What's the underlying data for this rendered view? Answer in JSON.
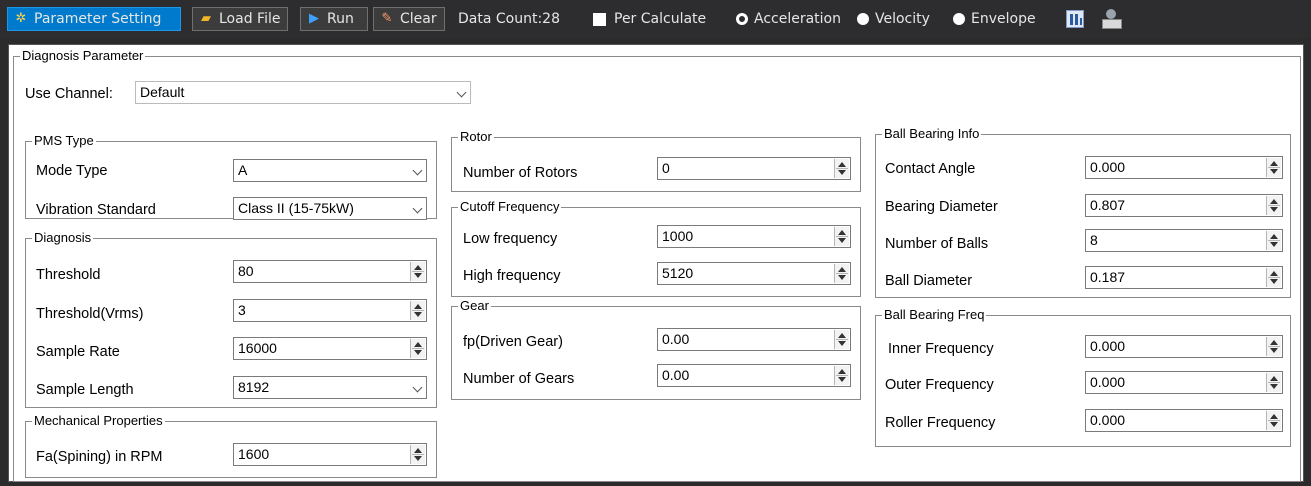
{
  "toolbar": {
    "param_setting": "Parameter Setting",
    "load_file": "Load File",
    "run": "Run",
    "clear": "Clear",
    "data_count": "Data Count:28",
    "per_calculate": "Per Calculate",
    "acceleration": "Acceleration",
    "velocity": "Velocity",
    "envelope": "Envelope",
    "selected_mode": "Acceleration"
  },
  "diagnosis": {
    "title": "Diagnosis Parameter",
    "use_channel_label": "Use Channel:",
    "use_channel_value": "Default"
  },
  "pms": {
    "title": "PMS Type",
    "mode_type_label": "Mode Type",
    "mode_type_value": "A",
    "vib_std_label": "Vibration Standard",
    "vib_std_value": "Class II (15-75kW)"
  },
  "diag": {
    "title": "Diagnosis",
    "threshold_label": "Threshold",
    "threshold_value": "80",
    "threshold_vrms_label": "Threshold(Vrms)",
    "threshold_vrms_value": "3",
    "sample_rate_label": "Sample Rate",
    "sample_rate_value": "16000",
    "sample_length_label": "Sample Length",
    "sample_length_value": "8192"
  },
  "mech": {
    "title": "Mechanical Properties",
    "fa_label": "Fa(Spining) in RPM",
    "fa_value": "1600"
  },
  "rotor": {
    "title": "Rotor",
    "num_label": "Number of Rotors",
    "num_value": "0"
  },
  "cutoff": {
    "title": "Cutoff Frequency",
    "low_label": "Low frequency",
    "low_value": "1000",
    "high_label": "High frequency",
    "high_value": "5120"
  },
  "gear": {
    "title": "Gear",
    "fp_label": "fp(Driven Gear)",
    "fp_value": "0.00",
    "num_label": "Number of Gears",
    "num_value": "0.00"
  },
  "bearing_info": {
    "title": "Ball Bearing Info",
    "contact_label": "Contact Angle",
    "contact_value": "0.000",
    "diameter_label": "Bearing Diameter",
    "diameter_value": "0.807",
    "balls_label": "Number of Balls",
    "balls_value": "8",
    "ball_dia_label": "Ball Diameter",
    "ball_dia_value": "0.187"
  },
  "bearing_freq": {
    "title": "Ball Bearing Freq",
    "inner_label": "Inner Frequency",
    "inner_value": "0.000",
    "outer_label": "Outer Frequency",
    "outer_value": "0.000",
    "roller_label": "Roller Frequency",
    "roller_value": "0.000"
  }
}
